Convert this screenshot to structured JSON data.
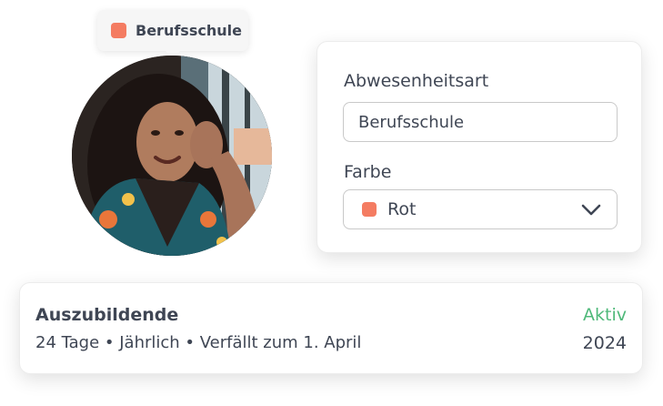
{
  "tooltip": {
    "label": "Berufsschule",
    "color": "#f47c62"
  },
  "avatar": {
    "icon": "person-photo"
  },
  "form": {
    "absence_type_label": "Abwesenheitsart",
    "absence_type_value": "Berufsschule",
    "color_label": "Farbe",
    "color_value": "Rot",
    "color_swatch": "#f47c62",
    "dropdown_icon": "chevron-down-icon"
  },
  "info": {
    "title": "Auszubildende",
    "details": "24 Tage • Jährlich • Verfällt zum 1. April",
    "status": "Aktiv",
    "status_color": "#4fb97a",
    "year": "2024"
  }
}
